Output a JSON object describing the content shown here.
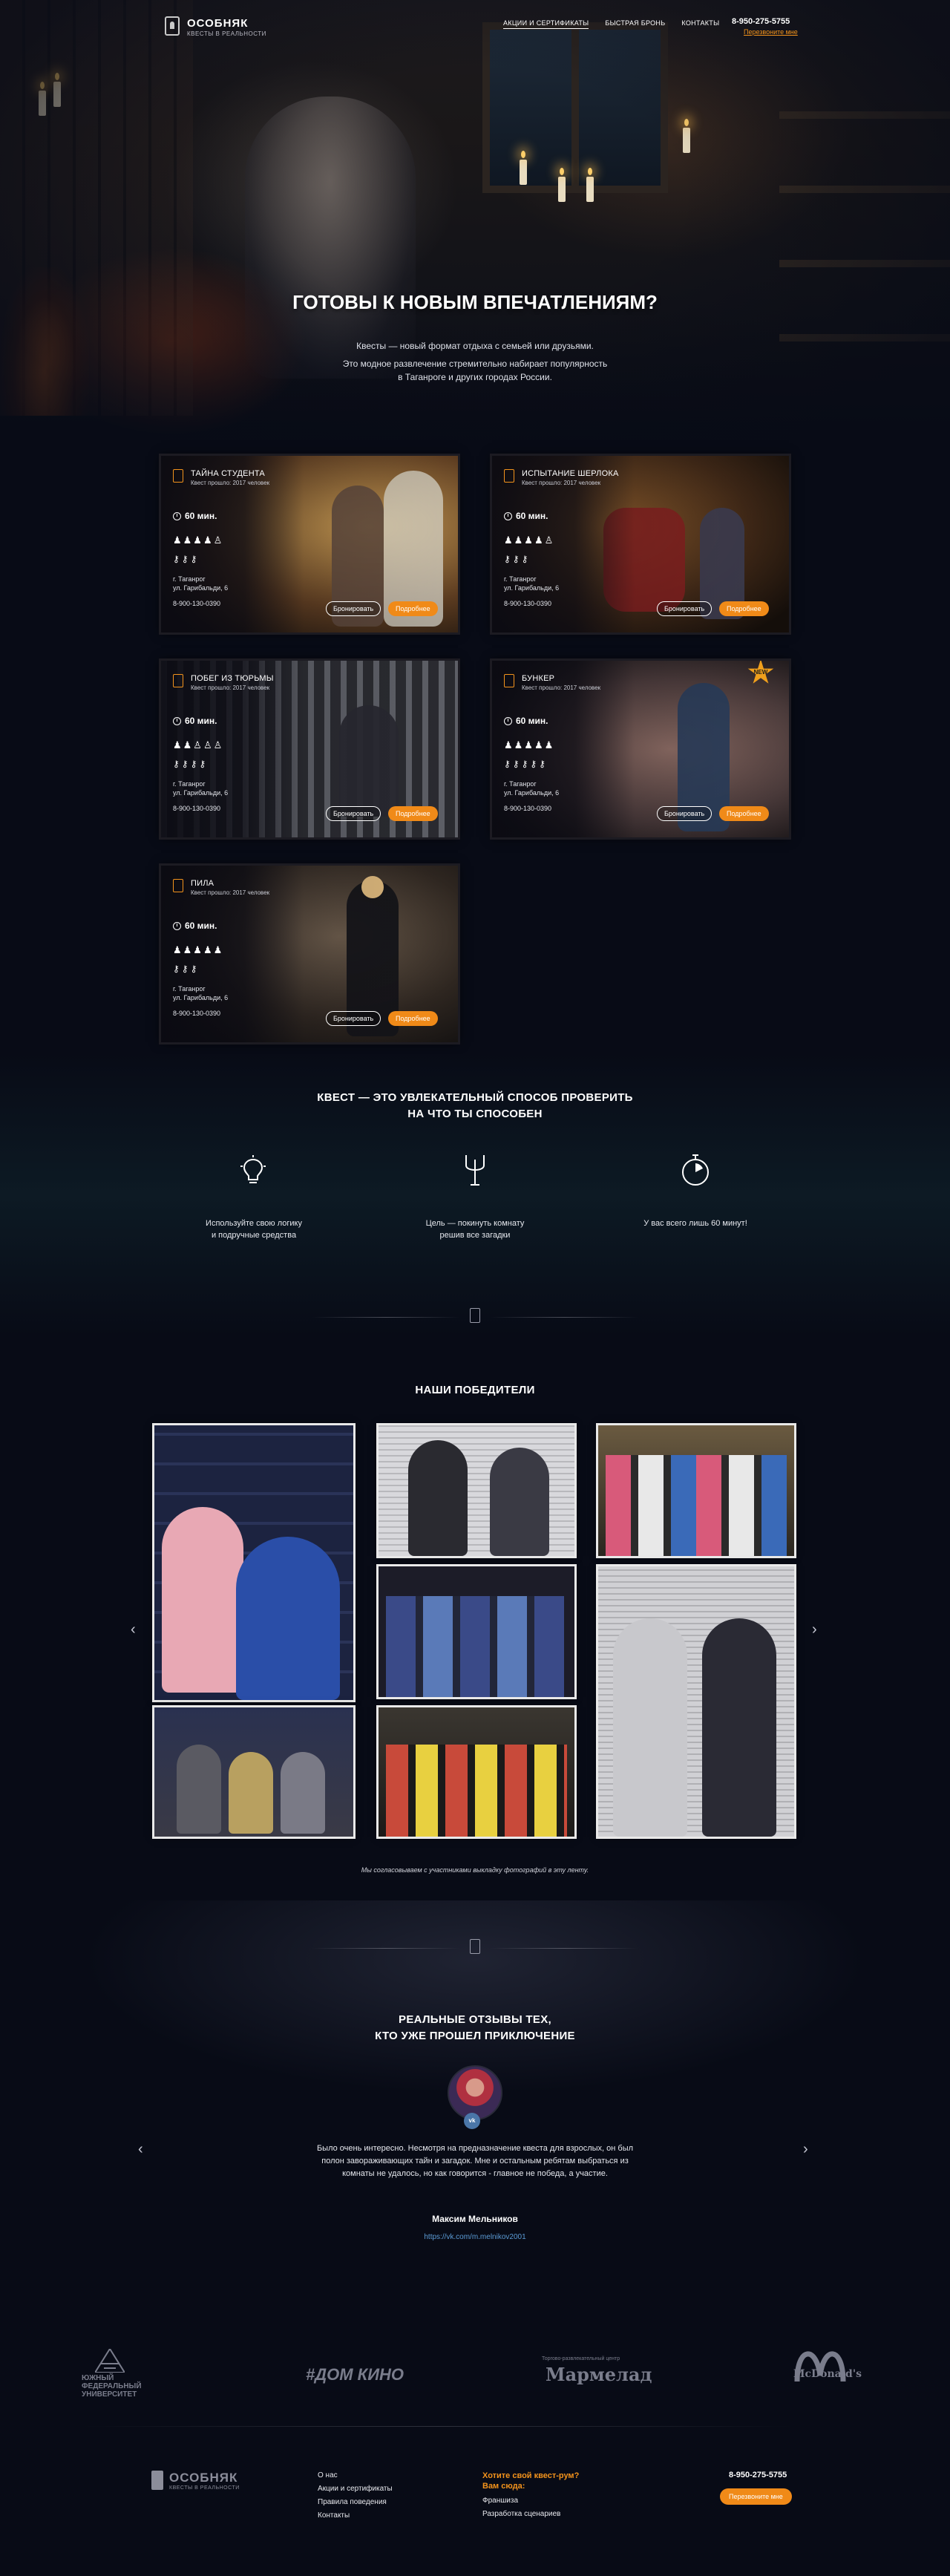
{
  "header": {
    "logo_title": "ОСОБНЯК",
    "logo_subtitle": "КВЕСТЫ В РЕАЛЬНОСТИ",
    "nav": [
      "АКЦИИ И СЕРТИФИКАТЫ",
      "БЫСТРАЯ БРОНЬ",
      "КОНТАКТЫ"
    ],
    "phone": "8-950-275-5755",
    "callback": "Перезвоните мне"
  },
  "hero": {
    "title": "ГОТОВЫ К НОВЫМ ВПЕЧАТЛЕНИЯМ?",
    "line1": "Квесты — новый формат отдыха с семьей или друзьями.",
    "line2": "Это модное развлечение стремительно набирает популярность",
    "line3": "в Таганроге и других городах России."
  },
  "quests": [
    {
      "name": "ТАЙНА СТУДЕНТА",
      "played": "Квест прошло: 2017 человек",
      "time": "60 мин.",
      "players": "♟♟♟♟♙",
      "keys": "⚷⚷⚷",
      "city": "г. Таганрог",
      "address": "ул. Гарибальди, 6",
      "phone": "8-900-130-0390",
      "book": "Бронировать",
      "more": "Подробнее"
    },
    {
      "name": "ИСПЫТАНИЕ ШЕРЛОКА",
      "played": "Квест прошло: 2017 человек",
      "time": "60 мин.",
      "players": "♟♟♟♟♙",
      "keys": "⚷⚷⚷",
      "city": "г. Таганрог",
      "address": "ул. Гарибальди, 6",
      "phone": "8-900-130-0390",
      "book": "Бронировать",
      "more": "Подробнее"
    },
    {
      "name": "ПОБЕГ ИЗ ТЮРЬМЫ",
      "played": "Квест прошло: 2017 человек",
      "time": "60 мин.",
      "players": "♟♟♙♙♙",
      "keys": "⚷⚷⚷⚷",
      "city": "г. Таганрог",
      "address": "ул. Гарибальди, 6",
      "phone": "8-900-130-0390",
      "book": "Бронировать",
      "more": "Подробнее"
    },
    {
      "name": "БУНКЕР",
      "played": "Квест прошло: 2017 человек",
      "time": "60 мин.",
      "players": "♟♟♟♟♟",
      "keys": "⚷⚷⚷⚷⚷",
      "city": "г. Таганрог",
      "address": "ул. Гарибальди, 6",
      "phone": "8-900-130-0390",
      "book": "Бронировать",
      "more": "Подробнее",
      "badge": "NEW"
    },
    {
      "name": "ПИЛА",
      "played": "Квест прошло: 2017 человек",
      "time": "60 мин.",
      "players": "♟♟♟♟♟",
      "keys": "⚷⚷⚷",
      "city": "г. Таганрог",
      "address": "ул. Гарибальди, 6",
      "phone": "8-900-130-0390",
      "book": "Бронировать",
      "more": "Подробнее"
    }
  ],
  "features": {
    "title_line1": "КВЕСТ — ЭТО УВЛЕКАТЕЛЬНЫЙ СПОСОБ ПРОВЕРИТЬ",
    "title_line2": "НА ЧТО ТЫ СПОСОБЕН",
    "items": [
      {
        "icon": "lightbulb-icon",
        "line1": "Используйте свою логику",
        "line2": "и подручные средства"
      },
      {
        "icon": "tuning-fork-icon",
        "line1": "Цель — покинуть комнату",
        "line2": "решив все загадки"
      },
      {
        "icon": "stopwatch-icon",
        "line1": "У вас всего лишь 60 минут!",
        "line2": ""
      }
    ]
  },
  "winners": {
    "title": "НАШИ ПОБЕДИТЕЛИ",
    "prev": "‹",
    "next": "›",
    "note": "Мы согласовываем с участниками выкладку фотографий в эту ленту."
  },
  "reviews": {
    "title_line1": "РЕАЛЬНЫЕ ОТЗЫВЫ ТЕХ,",
    "title_line2": "КТО УЖЕ ПРОШЕЛ ПРИКЛЮЧЕНИЕ",
    "vk": "vk",
    "text": "Было очень интересно. Несмотря на предназначение квеста для взрослых, он был полон завораживающих тайн и загадок. Мне и остальным ребятам выбраться из комнаты не удалось, но как говорится - главное не победа, а участие.",
    "author": "Максим Мельников",
    "link": "https://vk.com/m.melnikov2001",
    "prev": "‹",
    "next": "›"
  },
  "partners": {
    "p1_line1": "ЮЖНЫЙ",
    "p1_line2": "ФЕДЕРАЛЬНЫЙ",
    "p1_line3": "УНИВЕРСИТЕТ",
    "p2": "#ДОМ КИНО",
    "p3_small": "Торгово-развлекательный центр",
    "p3": "Мармелад",
    "p4": "McDonald's"
  },
  "footer": {
    "logo_title": "ОСОБНЯК",
    "logo_subtitle": "КВЕСТЫ В РЕАЛЬНОСТИ",
    "links": [
      "О нас",
      "Акции и сертификаты",
      "Правила поведения",
      "Контакты"
    ],
    "cta_line1": "Хотите свой квест-рум?",
    "cta_line2": "Вам сюда:",
    "cta_links": [
      "Франшиза",
      "Разработка сценариев"
    ],
    "phone": "8-950-275-5755",
    "callback": "Перезвоните мне"
  }
}
